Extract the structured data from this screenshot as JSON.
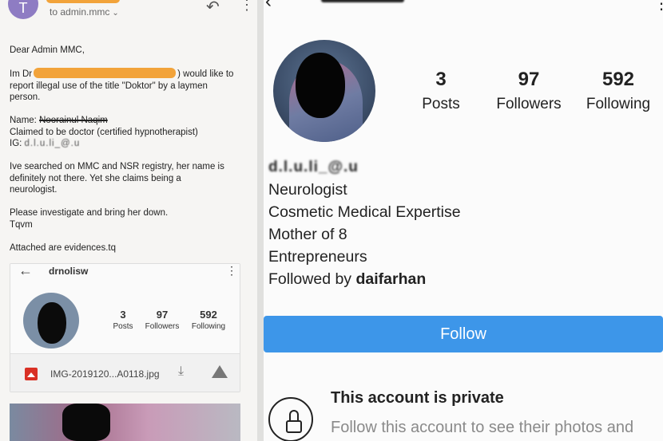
{
  "email": {
    "sender_initial": "T",
    "to_line": "to admin.mmc",
    "greeting": "Dear Admin MMC,",
    "para1_prefix": "Im Dr",
    "para1_suffix": ") would like to",
    "para1_line2": "report illegal use of the title \"Doktor\" by a laymen",
    "para1_line3": "person.",
    "name_label": "Name: ",
    "name_value": "Noorainul Naqim",
    "claimed": "Claimed to be doctor (certified hypnotherapist)",
    "ig_label": "IG: ",
    "ig_value": "d.l.u.li_@.u",
    "para2_line1": "Ive searched on MMC and NSR registry, her name is",
    "para2_line2": "definitely not there. Yet she claims being a",
    "para2_line3": "neurologist.",
    "para3_line1": "Please investigate and bring her down.",
    "para3_line2": "Tqvm",
    "closing": "Attached are evidences.tq"
  },
  "attachment": {
    "username": "drnolisw",
    "posts_num": "3",
    "posts_label": "Posts",
    "followers_num": "97",
    "followers_label": "Followers",
    "following_num": "592",
    "following_label": "Following",
    "filename": "IMG-2019120...A0118.jpg"
  },
  "profile": {
    "posts_num": "3",
    "posts_label": "Posts",
    "followers_num": "97",
    "followers_label": "Followers",
    "following_num": "592",
    "following_label": "Following",
    "username": "d.l.u.li_@.u",
    "bio": [
      "Neurologist",
      "Cosmetic Medical Expertise",
      "Mother of 8",
      "Entrepreneurs"
    ],
    "followed_prefix": "Followed by ",
    "followed_name": "daifarhan",
    "follow_button": "Follow",
    "private_title": "This account is private",
    "private_sub": "Follow this account to see their photos and videos."
  },
  "icons": {
    "reply": "reply-icon",
    "more": "more-vert-icon",
    "back": "back-arrow-icon",
    "image": "image-file-icon",
    "download": "download-icon",
    "drive": "drive-icon",
    "lock": "lock-icon"
  },
  "colors": {
    "redaction": "#f2a33a",
    "follow_button": "#3d96e9",
    "avatar_letter_bg": "#8e7cc3"
  }
}
